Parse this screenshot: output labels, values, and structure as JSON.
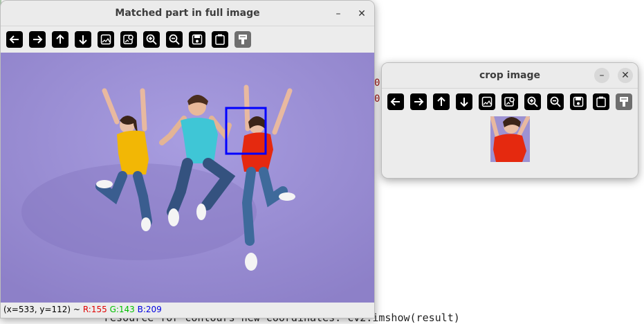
{
  "main_window": {
    "title": "Matched part in full image",
    "minimize_glyph": "–",
    "close_glyph": "✕",
    "status": {
      "coords": "(x=533, y=112) ~",
      "r": "R:155",
      "g": "G:143",
      "b": "B:209"
    }
  },
  "crop_window": {
    "title": "crop image",
    "minimize_glyph": "–",
    "close_glyph": "✕"
  },
  "toolbar_icons": [
    "arrow-left-icon",
    "arrow-right-icon",
    "arrow-up-icon",
    "arrow-down-icon",
    "image-icon",
    "image-search-icon",
    "zoom-in-icon",
    "zoom-out-icon",
    "save-icon",
    "clipboard-icon",
    "properties-icon"
  ],
  "background": {
    "marker_1": "0",
    "marker_2": "0",
    "code_fragment": "resource  for  contours  new  coordinates:  cv2.imshow(result)"
  },
  "colors": {
    "photo_background": "#9b8fd1",
    "match_box": "#0000ff",
    "yellow_shirt": "#f2b705",
    "cyan_shirt": "#3fc6d6",
    "red_shirt": "#e5290f"
  }
}
